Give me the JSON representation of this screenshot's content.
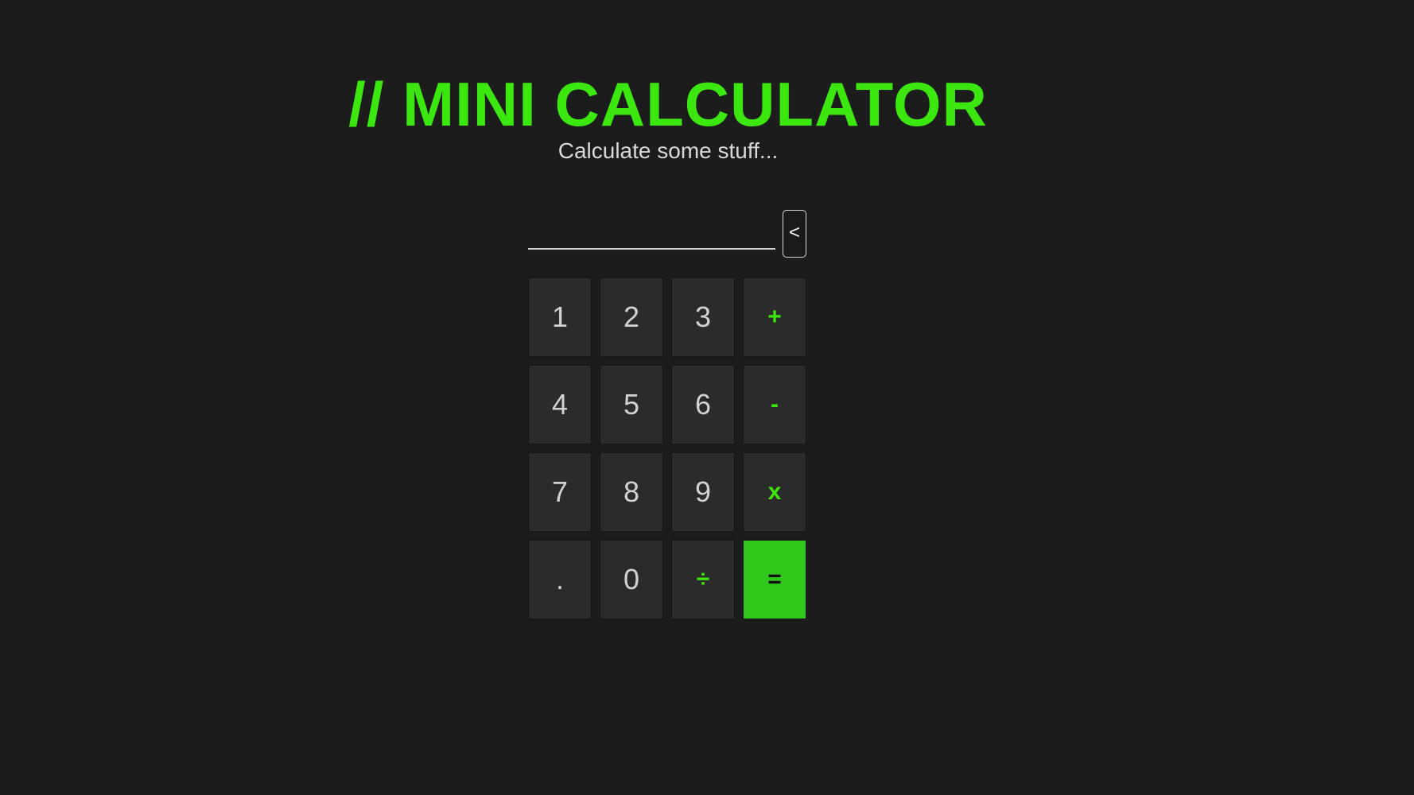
{
  "header": {
    "title": "// MINI CALCULATOR",
    "subtitle": "Calculate some stuff..."
  },
  "display": {
    "value": "",
    "backspace_label": "<"
  },
  "keypad": {
    "keys": [
      {
        "label": "1",
        "kind": "digit"
      },
      {
        "label": "2",
        "kind": "digit"
      },
      {
        "label": "3",
        "kind": "digit"
      },
      {
        "label": "+",
        "kind": "operator"
      },
      {
        "label": "4",
        "kind": "digit"
      },
      {
        "label": "5",
        "kind": "digit"
      },
      {
        "label": "6",
        "kind": "digit"
      },
      {
        "label": "-",
        "kind": "operator"
      },
      {
        "label": "7",
        "kind": "digit"
      },
      {
        "label": "8",
        "kind": "digit"
      },
      {
        "label": "9",
        "kind": "digit"
      },
      {
        "label": "x",
        "kind": "operator"
      },
      {
        "label": ".",
        "kind": "digit"
      },
      {
        "label": "0",
        "kind": "digit"
      },
      {
        "label": "÷",
        "kind": "operator"
      },
      {
        "label": "=",
        "kind": "equals"
      }
    ]
  },
  "colors": {
    "background": "#1c1c1c",
    "accent": "#3be70f",
    "equals_bg": "#2fc71a",
    "key_bg": "#2b2b2b",
    "subtitle": "#d9d9d9"
  }
}
